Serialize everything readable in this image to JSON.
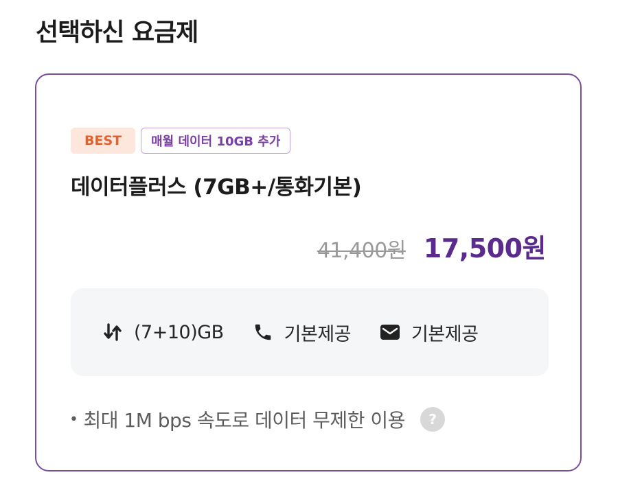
{
  "section": {
    "title": "선택하신 요금제"
  },
  "plan": {
    "badges": {
      "best": "BEST",
      "promo": "매월 데이터 10GB 추가"
    },
    "name": "데이터플러스 (7GB+/통화기본)",
    "price": {
      "original": "41,400원",
      "sale": "17,500원"
    },
    "benefits": [
      {
        "icon": "data-transfer-icon",
        "label": "(7+10)GB"
      },
      {
        "icon": "phone-icon",
        "label": "기본제공"
      },
      {
        "icon": "mail-icon",
        "label": "기본제공"
      }
    ],
    "note": {
      "bullet": "•",
      "text": "최대 1M bps 속도로 데이터 무제한 이용",
      "help_icon": "?"
    }
  },
  "colors": {
    "accent": "#5a2a8c",
    "card_border": "#7a4c9c",
    "best_bg": "#fde6dc",
    "best_text": "#e0622f",
    "promo_border": "#c4a3dd",
    "promo_text": "#7a3fa5",
    "benefits_bg": "#f5f6f8"
  }
}
